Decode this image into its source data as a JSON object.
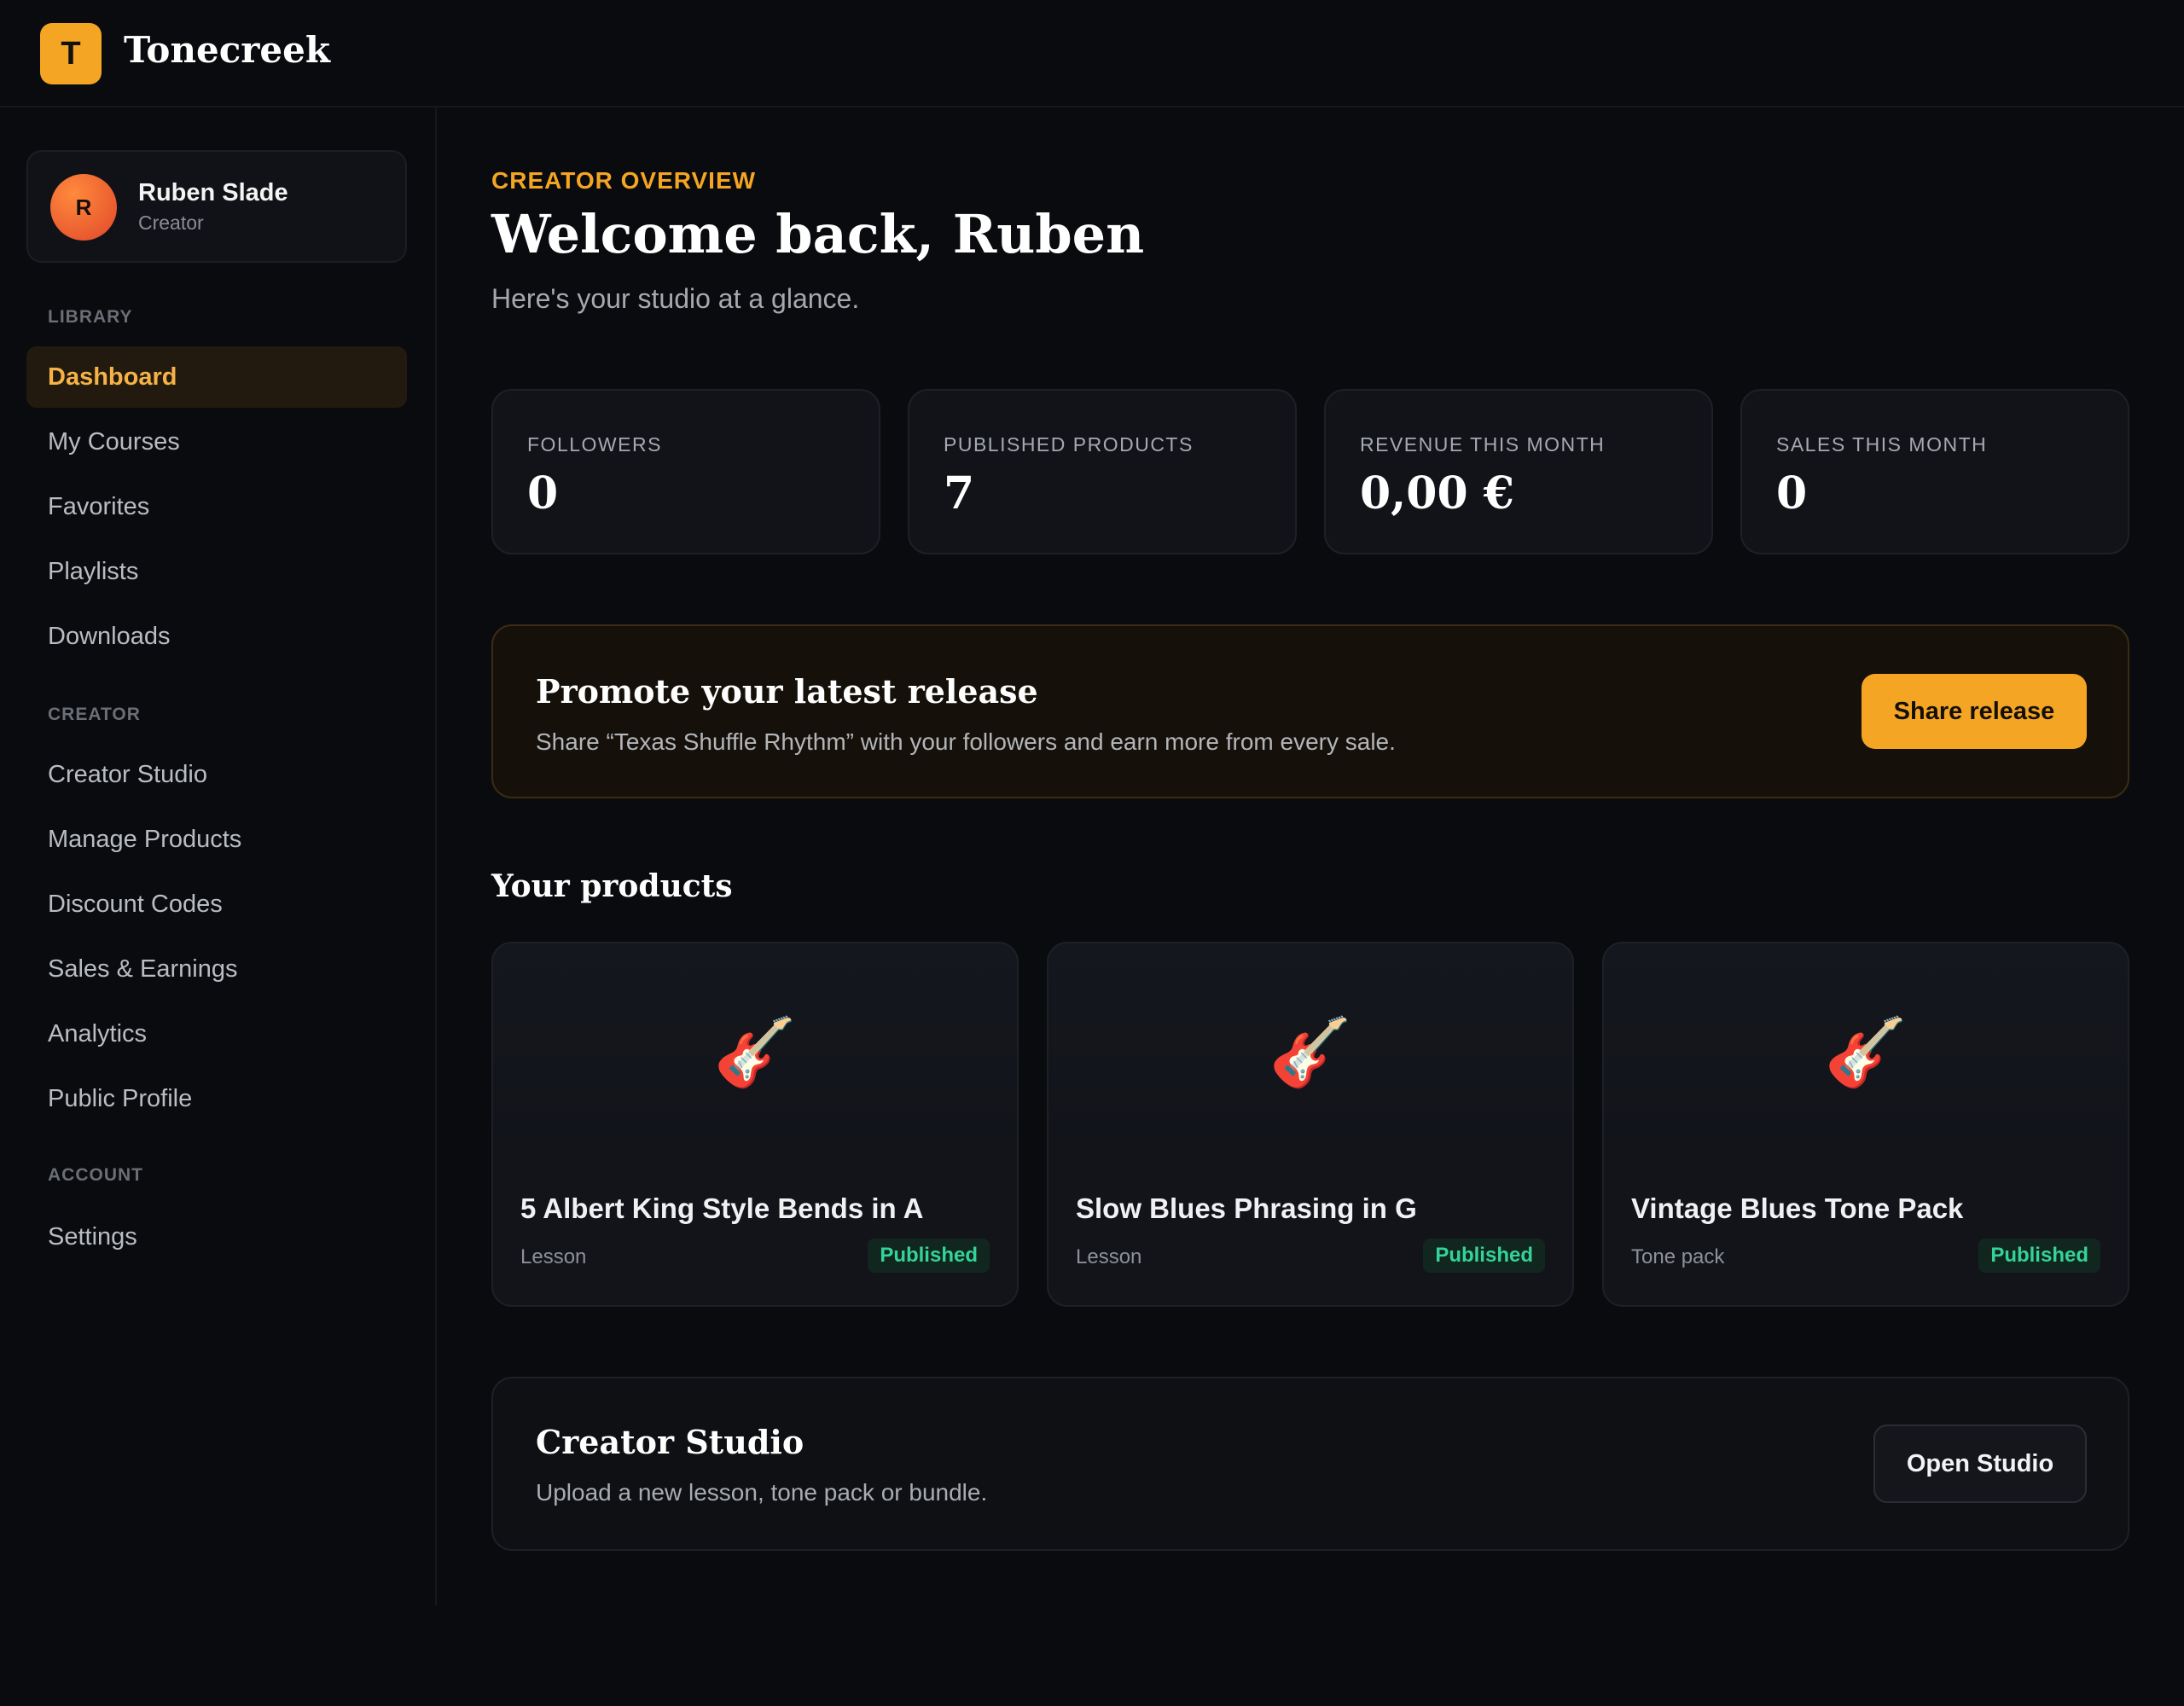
{
  "app": {
    "logo_letter": "T",
    "name": "Tonecreek"
  },
  "user": {
    "initial": "R",
    "name": "Ruben Slade",
    "role": "Creator"
  },
  "sidebar": {
    "sections": [
      {
        "label": "LIBRARY"
      },
      {
        "label": "CREATOR"
      },
      {
        "label": "ACCOUNT"
      }
    ],
    "library": [
      "Dashboard",
      "My Courses",
      "Favorites",
      "Playlists",
      "Downloads"
    ],
    "creator": [
      "Creator Studio",
      "Manage Products",
      "Discount Codes",
      "Sales & Earnings",
      "Analytics",
      "Public Profile"
    ],
    "account": [
      "Settings"
    ],
    "active": "Dashboard"
  },
  "header": {
    "eyebrow": "CREATOR OVERVIEW",
    "title": "Welcome back, Ruben",
    "subtitle": "Here's your studio at a glance."
  },
  "stats": [
    {
      "label": "FOLLOWERS",
      "value": "0"
    },
    {
      "label": "PUBLISHED PRODUCTS",
      "value": "7"
    },
    {
      "label": "REVENUE THIS MONTH",
      "value": "0,00 €"
    },
    {
      "label": "SALES THIS MONTH",
      "value": "0"
    }
  ],
  "promo": {
    "title": "Promote your latest release",
    "text": "Share “Texas Shuffle Rhythm” with your followers and earn more from every sale.",
    "button": "Share release"
  },
  "products_section": {
    "title": "Your products"
  },
  "products": [
    {
      "icon": "guitar-icon",
      "glyph": "🎸",
      "name": "5 Albert King Style Bends in A",
      "type": "Lesson",
      "status": "Published"
    },
    {
      "icon": "guitar-icon",
      "glyph": "🎸",
      "name": "Slow Blues Phrasing in G",
      "type": "Lesson",
      "status": "Published"
    },
    {
      "icon": "guitar-icon",
      "glyph": "🎸",
      "name": "Vintage Blues Tone Pack",
      "type": "Tone pack",
      "status": "Published"
    }
  ],
  "studio": {
    "title": "Creator Studio",
    "text": "Upload a new lesson, tone pack or bundle.",
    "button": "Open Studio"
  },
  "colors": {
    "accent": "#f5a524",
    "published": "#34d399",
    "background": "#0a0b0e"
  }
}
